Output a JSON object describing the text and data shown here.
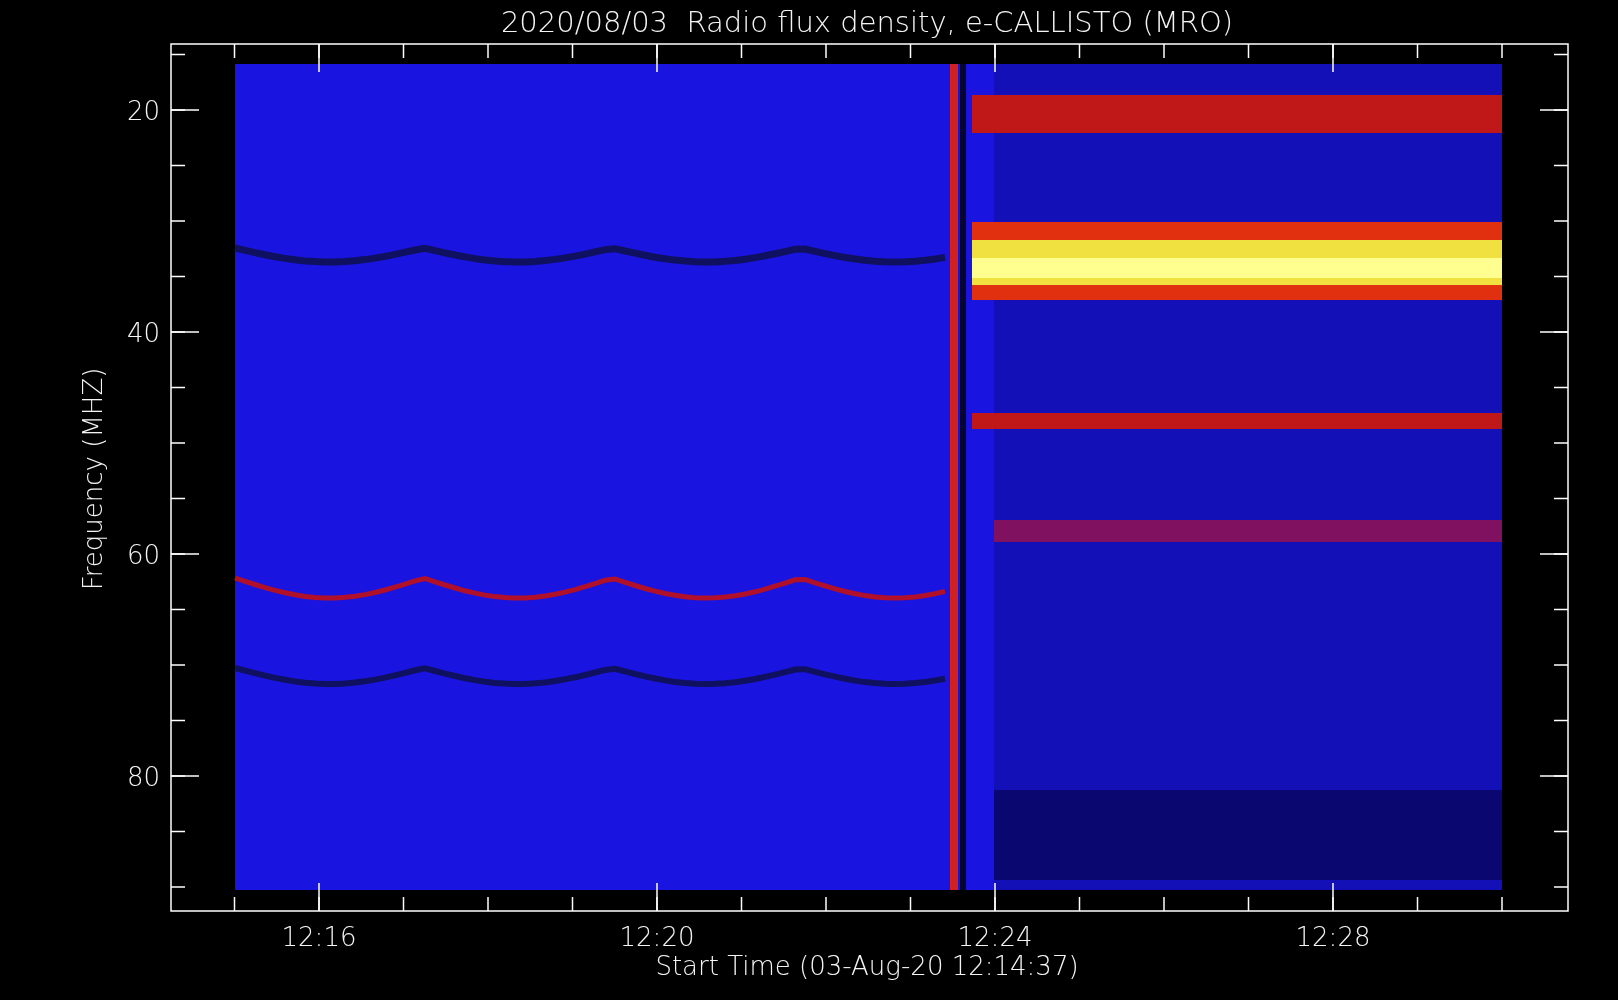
{
  "title": "2020/08/03  Radio flux density, e-CALLISTO (MRO)",
  "y_axis": {
    "label": "Frequency (MHZ)",
    "ticks": [
      "20",
      "40",
      "60",
      "80"
    ]
  },
  "x_axis": {
    "label": "Start Time (03-Aug-20 12:14:37)",
    "ticks": [
      "12:16",
      "12:20",
      "12:24",
      "12:28"
    ]
  }
}
